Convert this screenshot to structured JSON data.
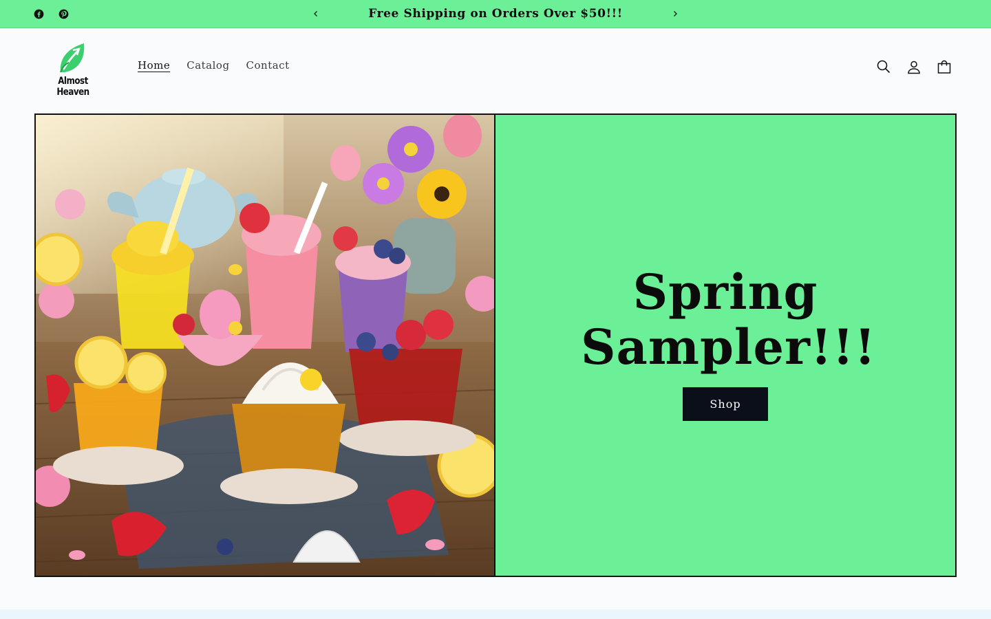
{
  "announcement": {
    "text": "Free Shipping on Orders Over $50!!!",
    "prev_icon": "chevron-left-icon",
    "next_icon": "chevron-right-icon",
    "social": [
      "facebook-icon",
      "pinterest-icon"
    ],
    "background": "#6bf098"
  },
  "header": {
    "logo_text": "Almost Heaven",
    "nav": [
      {
        "label": "Home",
        "active": true
      },
      {
        "label": "Catalog",
        "active": false
      },
      {
        "label": "Contact",
        "active": false
      }
    ],
    "icons": [
      "search-icon",
      "account-icon",
      "cart-icon"
    ]
  },
  "hero": {
    "heading": "Spring Sampler!!!",
    "button_label": "Shop",
    "panel_color": "#6bf098",
    "button_color": "#0b0f19"
  }
}
